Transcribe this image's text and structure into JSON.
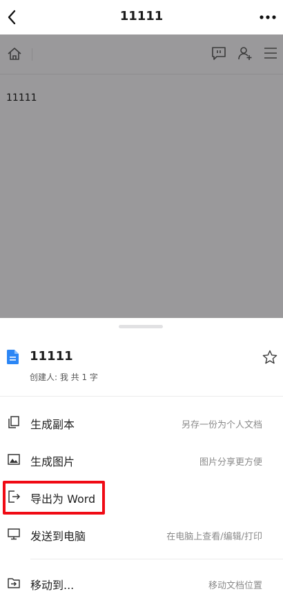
{
  "topbar": {
    "title": "11111"
  },
  "document": {
    "body_text": "11111"
  },
  "sheet": {
    "doc_name": "11111",
    "doc_meta": "创建人: 我 共 1 字"
  },
  "menu": {
    "items": [
      {
        "label": "生成副本",
        "desc": "另存一份为个人文档"
      },
      {
        "label": "生成图片",
        "desc": "图片分享更方便"
      },
      {
        "label": "导出为 Word",
        "desc": ""
      },
      {
        "label": "发送到电脑",
        "desc": "在电脑上查看/编辑/打印"
      },
      {
        "label": "移动到...",
        "desc": "移动文档位置"
      }
    ]
  },
  "colors": {
    "overlay": "#9a999b",
    "doc_icon": "#2b86f5",
    "highlight": "#f00a14"
  }
}
